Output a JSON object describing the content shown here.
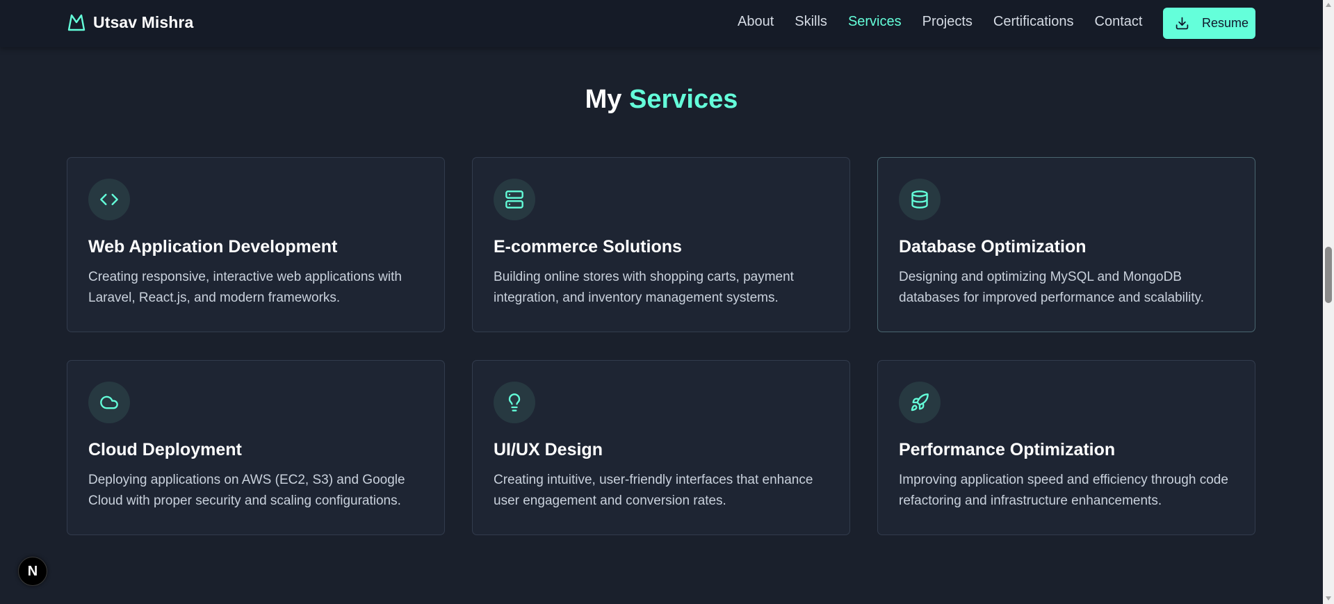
{
  "brand": {
    "name": "Utsav Mishra",
    "logo_icon": "mountain-logo-icon"
  },
  "nav": {
    "links": [
      "About",
      "Skills",
      "Services",
      "Projects",
      "Certifications",
      "Contact"
    ],
    "active": "Services",
    "resume_label": "Resume",
    "resume_icon": "download-icon"
  },
  "section": {
    "title_prefix": "My",
    "title_accent": "Services"
  },
  "services": [
    {
      "icon": "code-icon",
      "title": "Web Application Development",
      "description": "Creating responsive, interactive web applications with Laravel, React.js, and modern frameworks."
    },
    {
      "icon": "server-icon",
      "title": "E-commerce Solutions",
      "description": "Building online stores with shopping carts, payment integration, and inventory management systems."
    },
    {
      "icon": "database-icon",
      "title": "Database Optimization",
      "description": "Designing and optimizing MySQL and MongoDB databases for improved performance and scalability."
    },
    {
      "icon": "cloud-icon",
      "title": "Cloud Deployment",
      "description": "Deploying applications on AWS (EC2, S3) and Google Cloud with proper security and scaling configurations."
    },
    {
      "icon": "lightbulb-icon",
      "title": "UI/UX Design",
      "description": "Creating intuitive, user-friendly interfaces that enhance user engagement and conversion rates."
    },
    {
      "icon": "rocket-icon",
      "title": "Performance Optimization",
      "description": "Improving application speed and efficiency through code refactoring and infrastructure enhancements."
    }
  ],
  "badge": {
    "letter": "N"
  },
  "colors": {
    "accent": "#64ffda",
    "background": "#1a202c",
    "card": "#1e2533",
    "nav": "#151b27"
  }
}
